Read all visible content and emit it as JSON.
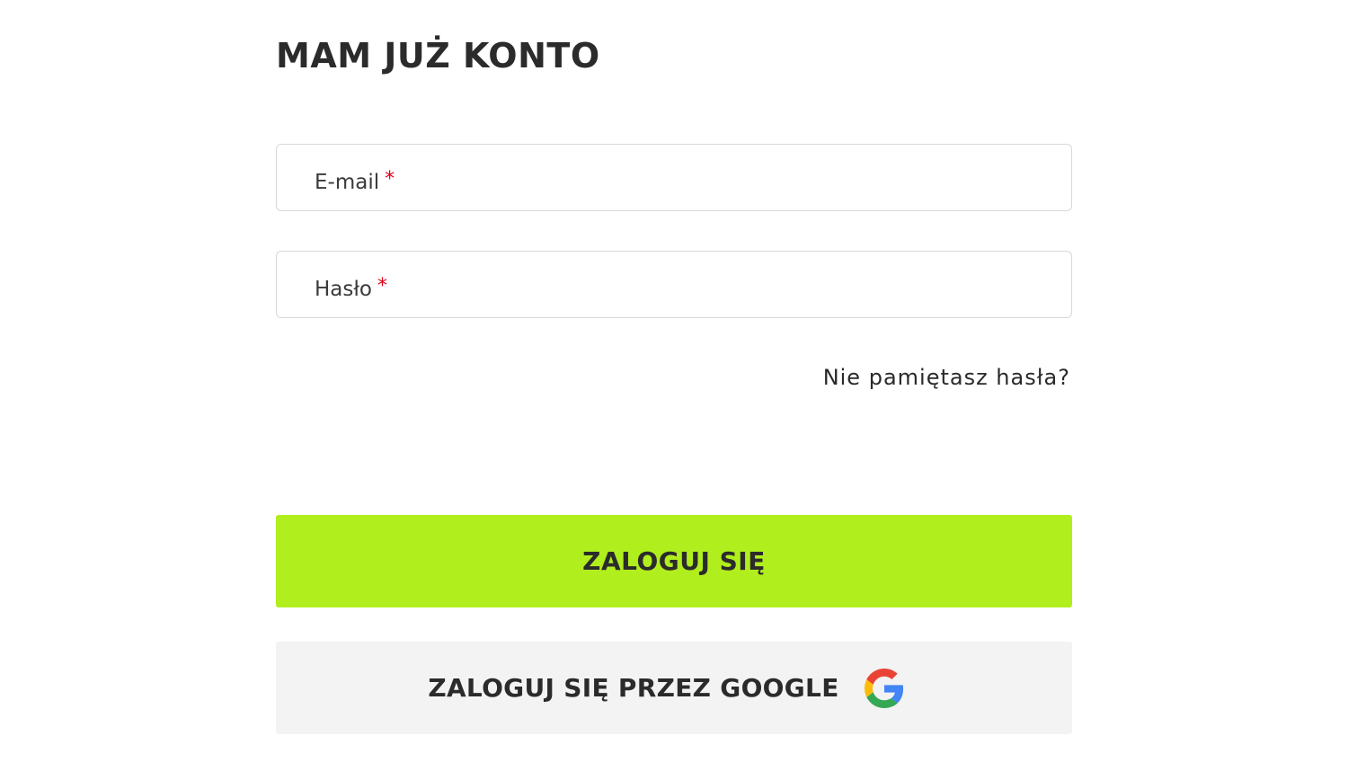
{
  "login": {
    "title": "MAM JUŻ KONTO",
    "email_label": "E-mail",
    "password_label": "Hasło",
    "required_mark": "*",
    "forgot_password": "Nie pamiętasz hasła?",
    "login_button": "ZALOGUJ SIĘ",
    "google_button": "ZALOGUJ SIĘ PRZEZ GOOGLE"
  },
  "colors": {
    "accent": "#b1ee1d",
    "required": "#e2001a",
    "secondary_button_bg": "#f3f3f3",
    "field_border": "#d8d8d8"
  },
  "icons": {
    "google": "google-logo-icon"
  }
}
